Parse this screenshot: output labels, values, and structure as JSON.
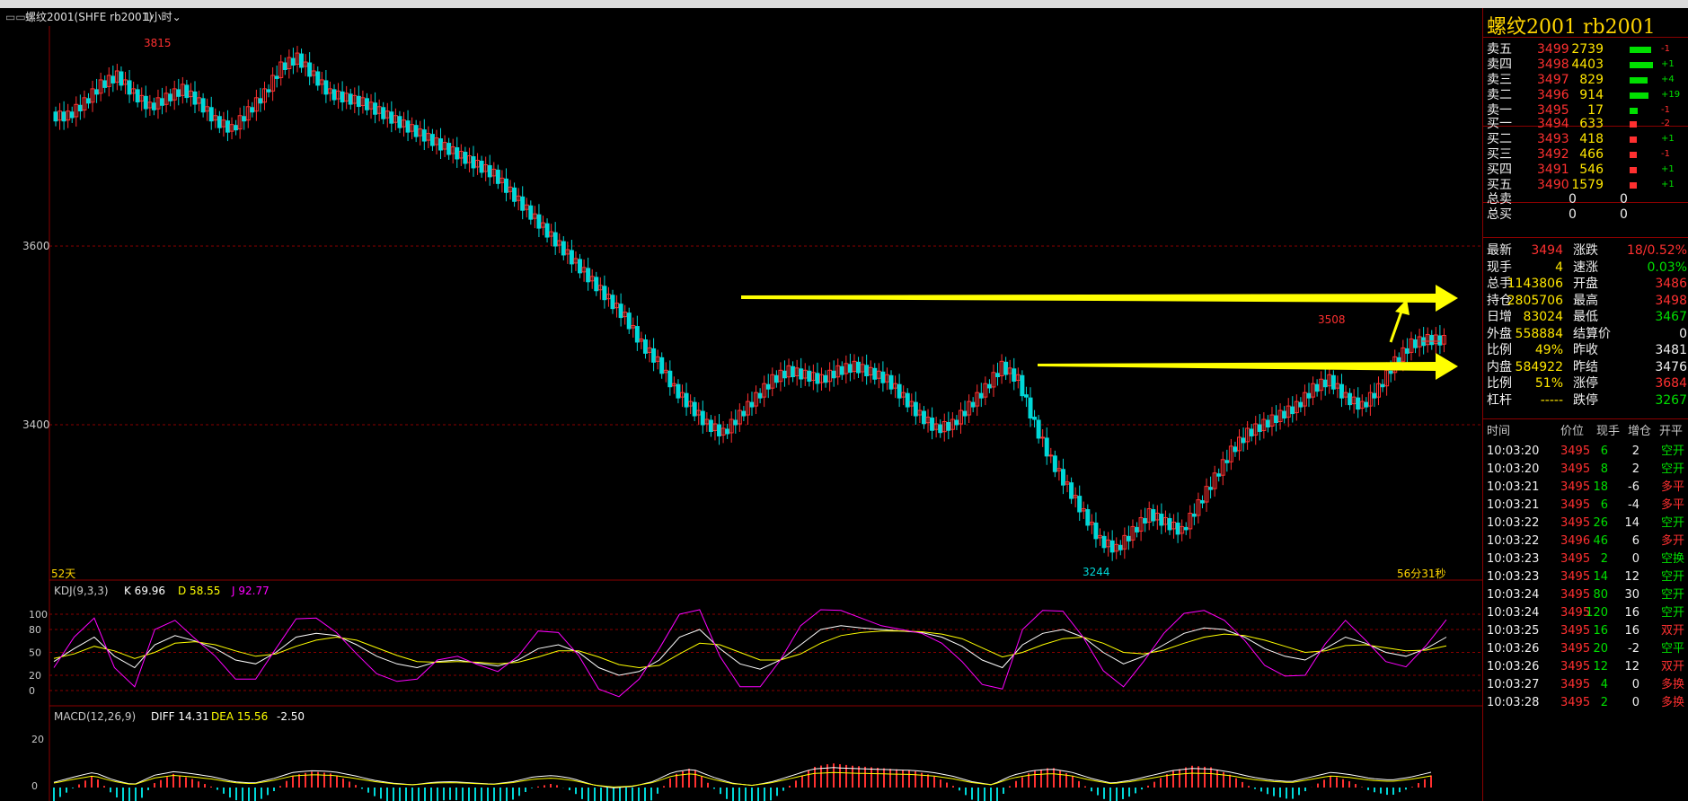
{
  "window": {
    "tab_label": "螺纹2001(SHFE rb2001)",
    "period": "1小时"
  },
  "main_chart": {
    "y_ticks": [
      "3600",
      "3400"
    ],
    "high_label": "3815",
    "low_label": "3244",
    "recent_high_label": "3508",
    "bar_count_label": "52天",
    "countdown_label": "56分31秒"
  },
  "chart_data": [
    {
      "type": "candlestick",
      "title": "螺纹2001(SHFE rb2001) 1小时",
      "yticks": [
        3600,
        3400
      ],
      "high": 3815,
      "low": 3244,
      "recent_high": 3508,
      "support_lines": [
        3540,
        3463
      ],
      "series": [
        {
          "name": "close",
          "values": [
            3745,
            3760,
            3780,
            3790,
            3770,
            3755,
            3765,
            3775,
            3760,
            3740,
            3730,
            3750,
            3770,
            3800,
            3810,
            3790,
            3770,
            3765,
            3760,
            3750,
            3740,
            3730,
            3720,
            3710,
            3700,
            3690,
            3680,
            3660,
            3640,
            3620,
            3600,
            3580,
            3560,
            3540,
            3520,
            3490,
            3470,
            3440,
            3420,
            3400,
            3390,
            3410,
            3430,
            3450,
            3460,
            3455,
            3450,
            3460,
            3465,
            3458,
            3450,
            3430,
            3410,
            3395,
            3400,
            3420,
            3440,
            3465,
            3450,
            3400,
            3360,
            3330,
            3300,
            3270,
            3260,
            3280,
            3300,
            3290,
            3280,
            3310,
            3340,
            3370,
            3390,
            3400,
            3410,
            3420,
            3440,
            3450,
            3430,
            3420,
            3440,
            3470,
            3490,
            3495,
            3494
          ]
        }
      ]
    },
    {
      "type": "line",
      "title": "KDJ(9,3,3)",
      "yticks": [
        100,
        80,
        50,
        20,
        0
      ],
      "series": [
        {
          "name": "K",
          "values": [
            38,
            55,
            70,
            45,
            30,
            60,
            72,
            65,
            55,
            40,
            35,
            50,
            70,
            75,
            72,
            60,
            45,
            35,
            30,
            38,
            40,
            36,
            32,
            40,
            55,
            60,
            50,
            30,
            20,
            25,
            40,
            70,
            80,
            55,
            35,
            28,
            40,
            60,
            80,
            85,
            82,
            80,
            78,
            76,
            70,
            58,
            40,
            30,
            60,
            75,
            80,
            70,
            50,
            35,
            45,
            60,
            75,
            82,
            80,
            70,
            55,
            45,
            40,
            55,
            70,
            62,
            50,
            45,
            55,
            69.96
          ]
        },
        {
          "name": "D",
          "values": [
            42,
            48,
            58,
            52,
            42,
            50,
            62,
            64,
            60,
            52,
            45,
            48,
            58,
            66,
            70,
            66,
            56,
            46,
            38,
            37,
            38,
            37,
            35,
            37,
            44,
            52,
            52,
            44,
            34,
            30,
            33,
            48,
            62,
            60,
            50,
            40,
            40,
            48,
            62,
            72,
            76,
            78,
            78,
            77,
            74,
            68,
            56,
            44,
            50,
            60,
            68,
            70,
            62,
            50,
            48,
            53,
            62,
            70,
            74,
            72,
            66,
            58,
            50,
            52,
            59,
            60,
            56,
            52,
            53,
            58.55
          ]
        },
        {
          "name": "J",
          "values": [
            30,
            70,
            95,
            30,
            5,
            80,
            92,
            68,
            45,
            15,
            15,
            55,
            94,
            95,
            76,
            48,
            22,
            12,
            15,
            40,
            45,
            34,
            25,
            45,
            78,
            76,
            46,
            2,
            -8,
            15,
            55,
            100,
            110,
            45,
            5,
            5,
            40,
            85,
            110,
            105,
            95,
            85,
            80,
            75,
            62,
            38,
            8,
            2,
            80,
            105,
            104,
            70,
            26,
            5,
            38,
            75,
            101,
            105,
            92,
            66,
            33,
            19,
            20,
            61,
            92,
            66,
            38,
            31,
            59,
            92.77
          ]
        }
      ]
    },
    {
      "type": "bar",
      "title": "MACD(12,26,9)",
      "yticks": [
        20,
        0
      ],
      "series": [
        {
          "name": "DIFF",
          "values": [
            14.31
          ]
        },
        {
          "name": "DEA",
          "values": [
            15.56
          ]
        },
        {
          "name": "MACD",
          "values": [
            -2.5
          ]
        }
      ]
    }
  ],
  "kdj_header": {
    "name": "KDJ(9,3,3)",
    "k": "K 69.96",
    "d": "D 58.55",
    "j": "J 92.77",
    "ticks": [
      "100",
      "80",
      "50",
      "20",
      "0"
    ]
  },
  "macd_header": {
    "name": "MACD(12,26,9)",
    "diff": "DIFF 14.31",
    "dea": "DEA 15.56",
    "macd": "-2.50",
    "ticks": [
      "20",
      "0"
    ]
  },
  "quote": {
    "title": "螺纹2001 rb2001",
    "asks": [
      {
        "label": "卖五",
        "price": "3499",
        "vol": "2739",
        "chg": "-1"
      },
      {
        "label": "卖四",
        "price": "3498",
        "vol": "4403",
        "chg": "+1"
      },
      {
        "label": "卖三",
        "price": "3497",
        "vol": "829",
        "chg": "+4"
      },
      {
        "label": "卖二",
        "price": "3496",
        "vol": "914",
        "chg": "+19"
      },
      {
        "label": "卖一",
        "price": "3495",
        "vol": "17",
        "chg": "-1"
      }
    ],
    "bids": [
      {
        "label": "买一",
        "price": "3494",
        "vol": "633",
        "chg": "-2"
      },
      {
        "label": "买二",
        "price": "3493",
        "vol": "418",
        "chg": "+1"
      },
      {
        "label": "买三",
        "price": "3492",
        "vol": "466",
        "chg": "-1"
      },
      {
        "label": "买四",
        "price": "3491",
        "vol": "546",
        "chg": "+1"
      },
      {
        "label": "买五",
        "price": "3490",
        "vol": "1579",
        "chg": "+1"
      }
    ],
    "totals": [
      {
        "label": "总卖",
        "a": "0",
        "b": "0"
      },
      {
        "label": "总买",
        "a": "0",
        "b": "0"
      }
    ],
    "stats": [
      {
        "l1": "最新",
        "v1": "3494",
        "l2": "涨跌",
        "v2": "18/0.52%"
      },
      {
        "l1": "现手",
        "v1": "4",
        "l2": "速涨",
        "v2": "0.03%"
      },
      {
        "l1": "总手",
        "v1": "1143806",
        "l2": "开盘",
        "v2": "3486"
      },
      {
        "l1": "持仓",
        "v1": "2805706",
        "l2": "最高",
        "v2": "3498"
      },
      {
        "l1": "日增",
        "v1": "83024",
        "l2": "最低",
        "v2": "3467"
      },
      {
        "l1": "外盘",
        "v1": "558884",
        "l2": "结算价",
        "v2": "0"
      },
      {
        "l1": "比例",
        "v1": "49%",
        "l2": "昨收",
        "v2": "3481"
      },
      {
        "l1": "内盘",
        "v1": "584922",
        "l2": "昨结",
        "v2": "3476"
      },
      {
        "l1": "比例",
        "v1": "51%",
        "l2": "涨停",
        "v2": "3684"
      },
      {
        "l1": "杠杆",
        "v1": "-----",
        "l2": "跌停",
        "v2": "3267"
      }
    ],
    "ticks_header": {
      "time": "时间",
      "price": "价位",
      "vol": "现手",
      "oi": "增仓",
      "type": "开平"
    },
    "ticks": [
      {
        "time": "10:03:20",
        "price": "3495",
        "vol": "6",
        "oi": "2",
        "type": "空开"
      },
      {
        "time": "10:03:20",
        "price": "3495",
        "vol": "8",
        "oi": "2",
        "type": "空开"
      },
      {
        "time": "10:03:21",
        "price": "3495",
        "vol": "18",
        "oi": "-6",
        "type": "多平"
      },
      {
        "time": "10:03:21",
        "price": "3495",
        "vol": "6",
        "oi": "-4",
        "type": "多平"
      },
      {
        "time": "10:03:22",
        "price": "3495",
        "vol": "26",
        "oi": "14",
        "type": "空开"
      },
      {
        "time": "10:03:22",
        "price": "3496",
        "vol": "46",
        "oi": "6",
        "type": "多开"
      },
      {
        "time": "10:03:23",
        "price": "3495",
        "vol": "2",
        "oi": "0",
        "type": "空换"
      },
      {
        "time": "10:03:23",
        "price": "3495",
        "vol": "14",
        "oi": "12",
        "type": "空开"
      },
      {
        "time": "10:03:24",
        "price": "3495",
        "vol": "80",
        "oi": "30",
        "type": "空开"
      },
      {
        "time": "10:03:24",
        "price": "3495",
        "vol": "120",
        "oi": "16",
        "type": "空开"
      },
      {
        "time": "10:03:25",
        "price": "3495",
        "vol": "16",
        "oi": "16",
        "type": "双开"
      },
      {
        "time": "10:03:26",
        "price": "3495",
        "vol": "20",
        "oi": "-2",
        "type": "空平"
      },
      {
        "time": "10:03:26",
        "price": "3495",
        "vol": "12",
        "oi": "12",
        "type": "双开"
      },
      {
        "time": "10:03:27",
        "price": "3495",
        "vol": "4",
        "oi": "0",
        "type": "多换"
      },
      {
        "time": "10:03:28",
        "price": "3495",
        "vol": "2",
        "oi": "0",
        "type": "多换"
      }
    ]
  },
  "colors": {
    "up": "#ff3030",
    "down": "#00d8d8",
    "arrow": "#ffff00",
    "grid": "#8a0000",
    "label": "#ffd400",
    "k": "#ffffff",
    "d": "#ffff00",
    "j": "#ff00ff"
  }
}
